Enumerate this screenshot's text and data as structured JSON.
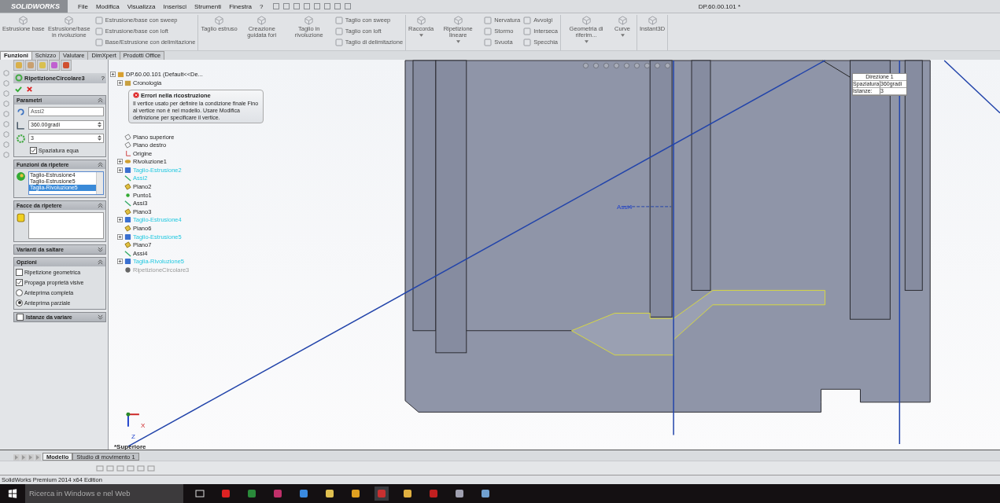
{
  "app": {
    "logo": "SOLIDWORKS",
    "menu": [
      "File",
      "Modifica",
      "Visualizza",
      "Inserisci",
      "Strumenti",
      "Finestra",
      "?"
    ],
    "document_title": "DP.60.00.101 *"
  },
  "ribbon": {
    "groups": [
      {
        "large": [
          {
            "label": "Estrusione base",
            "dropdown": false
          },
          {
            "label": "Estrusione/base in rivoluzione",
            "dropdown": false
          }
        ],
        "small_columns": [
          [
            "Estrusione/base con sweep",
            "Estrusione/base con loft",
            "Base/Estrusione con delimitazione"
          ]
        ]
      },
      {
        "large": [
          {
            "label": "Taglio estruso",
            "dropdown": false
          },
          {
            "label": "Creazione guidata fori",
            "dropdown": false
          },
          {
            "label": "Taglio in rivoluzione",
            "dropdown": false
          }
        ],
        "small_columns": [
          [
            "Taglio con sweep",
            "Taglio con loft",
            "Taglio di delimitazione"
          ]
        ]
      },
      {
        "large": [
          {
            "label": "Raccorda",
            "dropdown": true
          },
          {
            "label": "Ripetizione lineare",
            "dropdown": true
          }
        ],
        "small_columns": [
          [
            "Nervatura",
            "Stormo",
            "Svuota"
          ],
          [
            "Avvolgi",
            "Interseca",
            "Specchia"
          ]
        ]
      },
      {
        "large": [
          {
            "label": "Geometria di riferim...",
            "dropdown": true
          },
          {
            "label": "Curve",
            "dropdown": true
          }
        ]
      },
      {
        "large": [
          {
            "label": "Instant3D",
            "dropdown": false
          }
        ]
      }
    ]
  },
  "command_tabs": [
    {
      "label": "Funzioni",
      "selected": true
    },
    {
      "label": "Schizzo",
      "selected": false
    },
    {
      "label": "Valutare",
      "selected": false
    },
    {
      "label": "DimXpert",
      "selected": false
    },
    {
      "label": "Prodotti Office",
      "selected": false
    }
  ],
  "property_manager": {
    "title": "RipetizioneCircolare3",
    "help": "?",
    "sections": [
      {
        "title": "Parametri",
        "expanded": true,
        "items": [
          {
            "kind": "field",
            "value": "Assi2"
          },
          {
            "kind": "spinner",
            "value": "360.00gradi"
          },
          {
            "kind": "spinner",
            "value": "3"
          },
          {
            "kind": "checkbox",
            "label": "Spaziatura equa",
            "checked": true
          }
        ]
      },
      {
        "title": "Funzioni da ripetere",
        "expanded": true,
        "items": [
          {
            "kind": "listbox",
            "options": [
              {
                "label": "Taglio-Estrusione4",
                "selected": false
              },
              {
                "label": "Taglio-Estrusione5",
                "selected": false
              },
              {
                "label": "Taglia-Rivoluzione5",
                "selected": true
              }
            ]
          }
        ]
      },
      {
        "title": "Facce da ripetere",
        "expanded": true,
        "items": [
          {
            "kind": "facebox"
          }
        ]
      },
      {
        "title": "Varianti da saltare",
        "expanded": false
      },
      {
        "title": "Opzioni",
        "expanded": true,
        "items": [
          {
            "kind": "checkbox",
            "label": "Ripetizione geometrica",
            "checked": false
          },
          {
            "kind": "checkbox",
            "label": "Propaga proprietà visive",
            "checked": true
          },
          {
            "kind": "radio",
            "label": "Anteprima completa",
            "selected": false
          },
          {
            "kind": "radio",
            "label": "Anteprima parziale",
            "selected": true
          }
        ]
      },
      {
        "title": "Istanze da variare",
        "expanded": false,
        "checked": false
      }
    ]
  },
  "tree": {
    "label": "DP.60.00.101  (Default<<De...",
    "children": [
      {
        "label": "Cronologia",
        "kind": "folder",
        "expandable": true,
        "highlighted": false,
        "disabled": false
      },
      {
        "label": "Piano superiore",
        "kind": "plane",
        "expandable": false,
        "highlighted": false,
        "disabled": false
      },
      {
        "label": "Piano destro",
        "kind": "plane",
        "expandable": false,
        "highlighted": false,
        "disabled": false
      },
      {
        "label": "Origine",
        "kind": "origin",
        "expandable": false,
        "highlighted": false,
        "disabled": false
      },
      {
        "label": "Rivoluzione1",
        "kind": "revolve",
        "expandable": true,
        "highlighted": false,
        "disabled": false
      },
      {
        "label": "Taglio-Estrusione2",
        "kind": "cut",
        "expandable": true,
        "highlighted": true,
        "disabled": false
      },
      {
        "label": "Assi2",
        "kind": "axis",
        "expandable": false,
        "highlighted": true,
        "disabled": false
      },
      {
        "label": "Piano2",
        "kind": "refplane",
        "expandable": false,
        "highlighted": false,
        "disabled": false
      },
      {
        "label": "Punto1",
        "kind": "point",
        "expandable": false,
        "highlighted": false,
        "disabled": false
      },
      {
        "label": "Assi3",
        "kind": "axis",
        "expandable": false,
        "highlighted": false,
        "disabled": false
      },
      {
        "label": "Piano3",
        "kind": "refplane",
        "expandable": false,
        "highlighted": false,
        "disabled": false
      },
      {
        "label": "Taglio-Estrusione4",
        "kind": "cut",
        "expandable": true,
        "highlighted": true,
        "disabled": false
      },
      {
        "label": "Piano6",
        "kind": "refplane",
        "expandable": false,
        "highlighted": false,
        "disabled": false
      },
      {
        "label": "Taglio-Estrusione5",
        "kind": "cut",
        "expandable": true,
        "highlighted": true,
        "disabled": false
      },
      {
        "label": "Piano7",
        "kind": "refplane",
        "expandable": false,
        "highlighted": false,
        "disabled": false
      },
      {
        "label": "Assi4",
        "kind": "axis",
        "expandable": false,
        "highlighted": false,
        "disabled": false
      },
      {
        "label": "Taglia-Rivoluzione5",
        "kind": "revolve-cut",
        "expandable": true,
        "highlighted": true,
        "disabled": false
      },
      {
        "label": "RipetizioneCircolare3",
        "kind": "pattern",
        "expandable": false,
        "highlighted": false,
        "disabled": true
      }
    ]
  },
  "error_tooltip": {
    "title": "Errori nella ricostruzione",
    "text": "Il vertice usato per definire la condizione finale Fino al vertice non è nel modello. Usare Modifica definizione per specificare il vertice."
  },
  "viewport": {
    "callout": {
      "title": "Direzione 1",
      "rows": [
        {
          "label": "Spaziatura:",
          "value": "360gradi"
        },
        {
          "label": "Istanze:",
          "value": "3"
        }
      ]
    },
    "axis_label": "Assi4",
    "view_name": "*Superiore",
    "triad": [
      "X",
      "Z"
    ]
  },
  "bottom_tabs": [
    {
      "label": "Modello",
      "selected": true
    },
    {
      "label": "Studio di movimento 1",
      "selected": false
    }
  ],
  "status_bar": "SolidWorks Premium 2014 x64 Edition",
  "taskbar": {
    "search_placeholder": "Ricerca in Windows e nel Web"
  }
}
